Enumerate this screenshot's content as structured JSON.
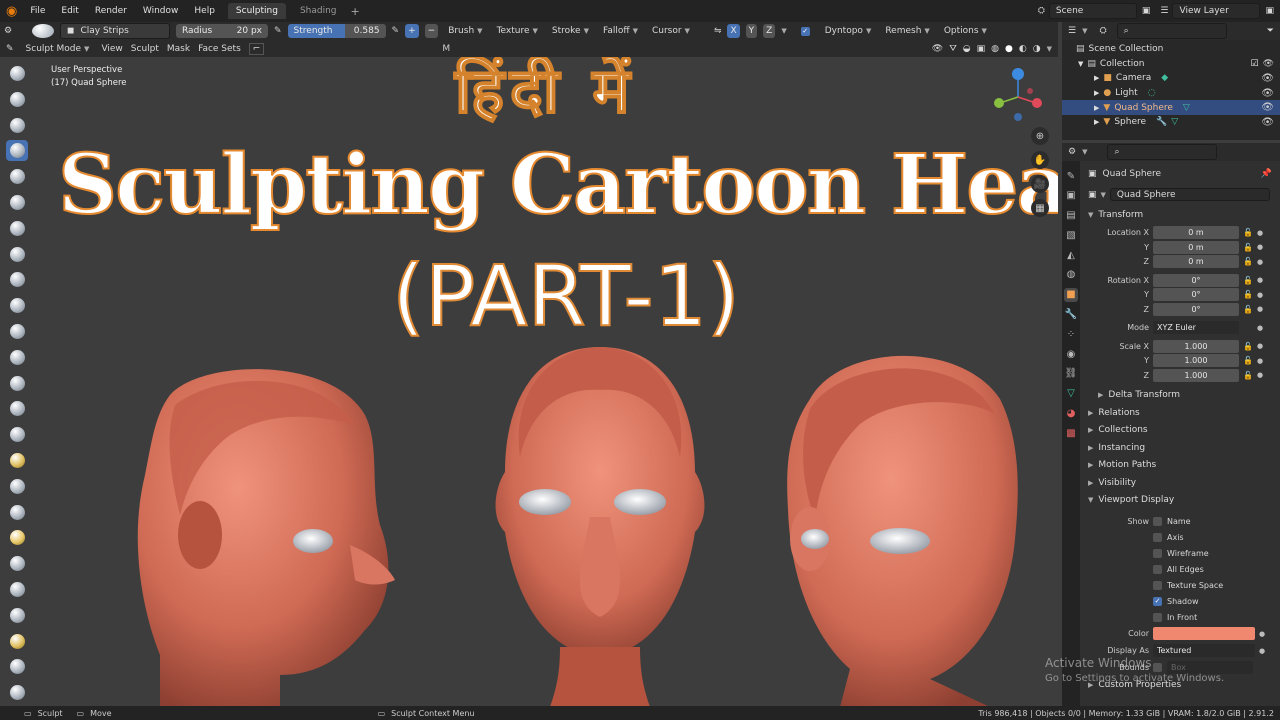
{
  "menubar": {
    "items": [
      "File",
      "Edit",
      "Render",
      "Window",
      "Help"
    ],
    "tabs": [
      {
        "label": "Sculpting",
        "active": true
      },
      {
        "label": "Shading",
        "active": false
      }
    ],
    "add_tab": "+",
    "scene": "Scene",
    "view_layer": "View Layer"
  },
  "tool_header": {
    "brush_name": "Clay Strips",
    "radius_label": "Radius",
    "radius_value": "20 px",
    "strength_label": "Strength",
    "strength_value": "0.585",
    "plus": "+",
    "minus": "−",
    "menus": [
      "Brush",
      "Texture",
      "Stroke",
      "Falloff",
      "Cursor"
    ],
    "xyz": [
      "X",
      "Y",
      "Z"
    ],
    "dyntopo": "Dyntopo",
    "remesh": "Remesh",
    "options": "Options"
  },
  "view_header": {
    "mode": "Sculpt Mode",
    "menus": [
      "View",
      "Sculpt",
      "Mask",
      "Face Sets"
    ],
    "overlay_label": "M"
  },
  "viewport": {
    "info_line1": "User Perspective",
    "info_line2": "(17) Quad Sphere",
    "title_hindi": "हिंदी में",
    "title_main": "Sculpting Cartoon Head",
    "title_part": "(PART-1)"
  },
  "status_bar": {
    "left_items": [
      "Sculpt",
      "Move",
      "Sculpt Context Menu"
    ],
    "stats": "Tris 986,418 | Objects 0/0 | Memory: 1.33 GiB | VRAM: 1.8/2.0 GiB | 2.91.2"
  },
  "outliner": {
    "items": [
      {
        "label": "Scene Collection",
        "indent": 0,
        "icon": "collection-icon",
        "selected": false
      },
      {
        "label": "Collection",
        "indent": 1,
        "icon": "collection-icon",
        "selected": false
      },
      {
        "label": "Camera",
        "indent": 2,
        "icon": "camera-icon",
        "selected": false
      },
      {
        "label": "Light",
        "indent": 2,
        "icon": "light-icon",
        "selected": false
      },
      {
        "label": "Quad Sphere",
        "indent": 2,
        "icon": "mesh-icon",
        "selected": true
      },
      {
        "label": "Sphere",
        "indent": 2,
        "icon": "mesh-icon",
        "selected": false
      }
    ]
  },
  "properties": {
    "object_name_top": "Quad Sphere",
    "object_name_field": "Quad Sphere",
    "transform_label": "Transform",
    "location": {
      "label": "Location X",
      "values": [
        "0 m",
        "0 m",
        "0 m"
      ]
    },
    "rotation": {
      "label": "Rotation X",
      "values": [
        "0°",
        "0°",
        "0°"
      ]
    },
    "mode_label": "Mode",
    "mode_value": "XYZ Euler",
    "scale": {
      "label": "Scale X",
      "values": [
        "1.000",
        "1.000",
        "1.000"
      ]
    },
    "axis_y": "Y",
    "axis_z": "Z",
    "delta_transform": "Delta Transform",
    "panels": [
      "Relations",
      "Collections",
      "Instancing",
      "Motion Paths",
      "Visibility"
    ],
    "viewport_display": "Viewport Display",
    "show_label": "Show",
    "show_options": [
      {
        "label": "Name",
        "checked": false
      },
      {
        "label": "Axis",
        "checked": false
      },
      {
        "label": "Wireframe",
        "checked": false
      },
      {
        "label": "All Edges",
        "checked": false
      },
      {
        "label": "Texture Space",
        "checked": false
      },
      {
        "label": "Shadow",
        "checked": true
      },
      {
        "label": "In Front",
        "checked": false
      }
    ],
    "color_label": "Color",
    "color_value": "#f08870",
    "display_as_label": "Display As",
    "display_as_value": "Textured",
    "bounds_label": "Bounds",
    "bounds_value": "Box",
    "custom_properties": "Custom Properties"
  },
  "watermark": {
    "line1": "Activate Windows",
    "line2": "Go to Settings to activate Windows."
  },
  "colors": {
    "accent": "#4772b3",
    "clay": "#d9705a",
    "title_stroke": "#e58a30"
  }
}
